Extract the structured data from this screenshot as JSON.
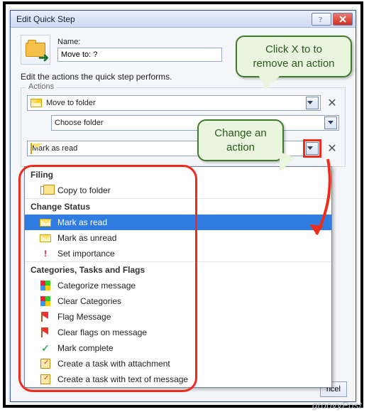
{
  "window": {
    "title": "Edit Quick Step"
  },
  "name_field": {
    "label": "Name:",
    "value": "Move to: ?"
  },
  "description": "Edit the actions the quick step performs.",
  "actions_group_label": "Actions",
  "action1": {
    "label": "Move to folder",
    "sub_label": "Choose folder"
  },
  "action2": {
    "label": "Mark as read"
  },
  "dropdown": {
    "g1": "Filing",
    "i1": "Copy to folder",
    "g2": "Change Status",
    "i2": "Mark as read",
    "i3": "Mark as unread",
    "i4": "Set importance",
    "g3": "Categories, Tasks and Flags",
    "i5": "Categorize message",
    "i6": "Clear Categories",
    "i7": "Flag Message",
    "i8": "Clear flags on message",
    "i9": "Mark complete",
    "i10": "Create a task with attachment",
    "i11": "Create a task with text of message"
  },
  "callout1_l1": "Click X to to",
  "callout1_l2": "remove an action",
  "callout2_l1": "Change an",
  "callout2_l2": "action",
  "cancel_fragment": "ncel",
  "watermark": "groovyPost"
}
